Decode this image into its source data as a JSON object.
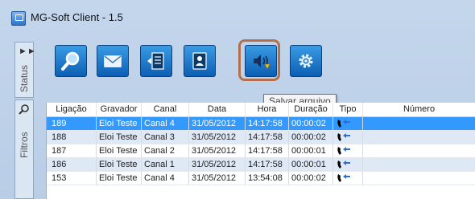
{
  "window": {
    "title": "MG-Soft Client - 1.5"
  },
  "side_tabs": [
    {
      "label": "Status",
      "icon": "expand-arrows-icon"
    },
    {
      "label": "Filtros",
      "icon": "search-icon"
    }
  ],
  "toolbar": {
    "buttons": [
      {
        "name": "search-button",
        "icon": "magnifier-icon"
      },
      {
        "name": "email-button",
        "icon": "envelope-icon"
      },
      {
        "name": "document-button",
        "icon": "document-icon"
      },
      {
        "name": "contacts-button",
        "icon": "contact-book-icon"
      },
      {
        "name": "save-file-button",
        "icon": "speaker-save-icon"
      },
      {
        "name": "settings-button",
        "icon": "gear-icon"
      }
    ],
    "tooltip": "Salvar arquivo"
  },
  "grid": {
    "columns": [
      "Ligação",
      "Gravador",
      "Canal",
      "Data",
      "Hora",
      "Duração",
      "Tipo",
      "Número"
    ],
    "rows": [
      {
        "ligacao": "189",
        "gravador": "Eloi Teste",
        "canal": "Canal 4",
        "data": "31/05/2012",
        "hora": "14:17:58",
        "duracao": "00:00:02",
        "tipo": "incoming-call-icon",
        "numero": ""
      },
      {
        "ligacao": "188",
        "gravador": "Eloi Teste",
        "canal": "Canal 3",
        "data": "31/05/2012",
        "hora": "14:17:58",
        "duracao": "00:00:02",
        "tipo": "incoming-call-icon",
        "numero": ""
      },
      {
        "ligacao": "187",
        "gravador": "Eloi Teste",
        "canal": "Canal 2",
        "data": "31/05/2012",
        "hora": "14:17:58",
        "duracao": "00:00:01",
        "tipo": "incoming-call-icon",
        "numero": ""
      },
      {
        "ligacao": "186",
        "gravador": "Eloi Teste",
        "canal": "Canal 1",
        "data": "31/05/2012",
        "hora": "14:17:58",
        "duracao": "00:00:01",
        "tipo": "incoming-call-icon",
        "numero": ""
      },
      {
        "ligacao": "153",
        "gravador": "Eloi Teste",
        "canal": "Canal 4",
        "data": "31/05/2012",
        "hora": "13:54:08",
        "duracao": "00:00:02",
        "tipo": "incoming-call-icon",
        "numero": ""
      }
    ],
    "selected_row": 0
  },
  "colors": {
    "selected_row": "#3399ff",
    "toolbar_button": "#1a74c8",
    "highlight_border": "#b3704c"
  }
}
